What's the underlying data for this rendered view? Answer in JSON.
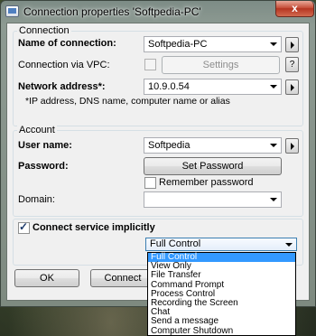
{
  "window": {
    "title": "Connection properties 'Softpedia-PC'",
    "close_label": "x"
  },
  "connection": {
    "group_label": "Connection",
    "name_label": "Name of connection:",
    "name_value": "Softpedia-PC",
    "vpc_label": "Connection via VPC:",
    "vpc_checked": false,
    "settings_label": "Settings",
    "help_label": "?",
    "address_label": "Network address*:",
    "address_value": "10.9.0.54",
    "address_hint": "*IP address, DNS name, computer name or alias"
  },
  "account": {
    "group_label": "Account",
    "user_label": "User name:",
    "user_value": "Softpedia",
    "password_label": "Password:",
    "set_password_label": "Set Password",
    "remember_label": "Remember password",
    "remember_checked": false,
    "domain_label": "Domain:",
    "domain_value": ""
  },
  "service": {
    "implicit_label": "Connect service implicitly",
    "implicit_checked": true,
    "selected_service": "Full Control",
    "options": [
      "Full Control",
      "View Only",
      "File Transfer",
      "Command Prompt",
      "Process Control",
      "Recording the Screen",
      "Chat",
      "Send a message",
      "Computer Shutdown"
    ]
  },
  "footer": {
    "ok_label": "OK",
    "connect_label": "Connect"
  },
  "colors": {
    "selection": "#3399ff",
    "close_button": "#c7503b"
  }
}
